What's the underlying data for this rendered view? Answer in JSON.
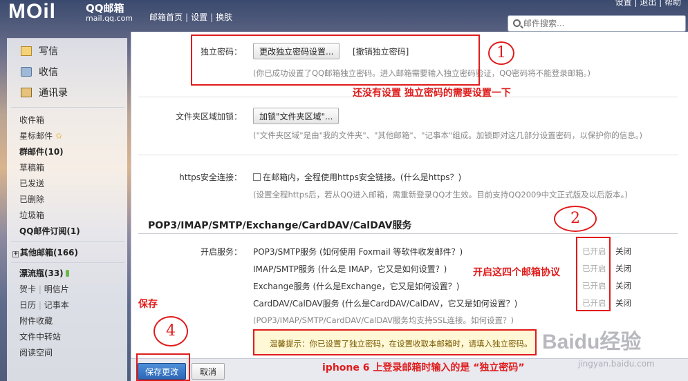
{
  "header": {
    "logo": "MOil",
    "logo_cn": "QQ邮箱",
    "logo_url": "mail.qq.com",
    "nav": [
      "邮箱首页",
      "设置",
      "换肤"
    ],
    "top_right": "设置 | 退出 | 帮助",
    "search_placeholder": "邮件搜索..."
  },
  "sidebar": {
    "main_items": [
      {
        "label": "写信",
        "icon": "pencil-icon"
      },
      {
        "label": "收信",
        "icon": "inbox-icon"
      },
      {
        "label": "通讯录",
        "icon": "contacts-icon"
      }
    ],
    "folders": [
      "收件箱",
      "星标邮件",
      "群邮件(10)",
      "草稿箱",
      "已发送",
      "已删除",
      "垃圾箱",
      "QQ邮件订阅(1)"
    ],
    "other_mailbox": "其他邮箱(166)",
    "drift_bottle": "漂流瓶(33)",
    "apps": {
      "card": "贺卡",
      "postcard": "明信片",
      "calendar": "日历",
      "notes": "记事本",
      "favorites": "附件收藏",
      "transfer": "文件中转站",
      "reading": "阅读空间"
    }
  },
  "security": {
    "password_label": "独立密码：",
    "change_password_button": "更改独立密码设置...",
    "cancel_password_link": "[撤销独立密码]",
    "password_hint": "(你已成功设置了QQ邮箱独立密码。进入邮箱需要输入独立密码验证，QQ密码将不能登录邮箱。)",
    "folder_lock_label": "文件夹区域加锁：",
    "folder_lock_button": "加锁\"文件夹区域\"...",
    "folder_lock_hint": "(\"文件夹区域\"是由\"我的文件夹\"、\"其他邮箱\"、\"记事本\"组成。加锁即对这几部分设置密码，以保护你的信息。)",
    "https_label": "https安全连接：",
    "https_option": "在邮箱内，全程使用https安全链接。(什么是https？)",
    "https_hint": "(设置全程https后，若从QQ进入邮箱，需重新登录QQ才生效。目前支持QQ2009中文正式版及以后版本。)"
  },
  "services": {
    "title": "POP3/IMAP/SMTP/Exchange/CardDAV/CalDAV服务",
    "enable_label": "开启服务：",
    "rows": [
      {
        "name": "POP3/SMTP服务 (如何使用 Foxmail 等软件收发邮件？)",
        "on": "已开启",
        "off": "关闭"
      },
      {
        "name": "IMAP/SMTP服务 (什么是 IMAP，它又是如何设置？)",
        "on": "已开启",
        "off": "关闭"
      },
      {
        "name": "Exchange服务 (什么是Exchange，它又是如何设置？)",
        "on": "已开启",
        "off": "关闭"
      },
      {
        "name": "CardDAV/CalDAV服务 (什么是CardDAV/CalDAV，它又是如何设置？)",
        "on": "已开启",
        "off": "关闭"
      }
    ],
    "ssl_hint": "(POP3/IMAP/SMTP/CardDAV/CalDAV服务均支持SSL连接。如何设置？)",
    "tip": "温馨提示：你已设置了独立密码，在设置收取本邮箱时，请填入独立密码。"
  },
  "footer": {
    "save": "保存更改",
    "cancel": "取消"
  },
  "annotations": {
    "circle1": "1",
    "circle2": "2",
    "circle4": "4",
    "note1": "还没有设置 独立密码的需要设置一下",
    "note2": "开启这四个邮箱协议",
    "note_save": "保存",
    "note_iphone": "iphone 6 上登录邮箱时输入的是 “独立密码”",
    "watermark": "Baidu经验",
    "watermark_sub": "jingyan.baidu.com"
  },
  "colors": {
    "annotation": "#e01b1b",
    "save_button": "#2b67b6"
  }
}
